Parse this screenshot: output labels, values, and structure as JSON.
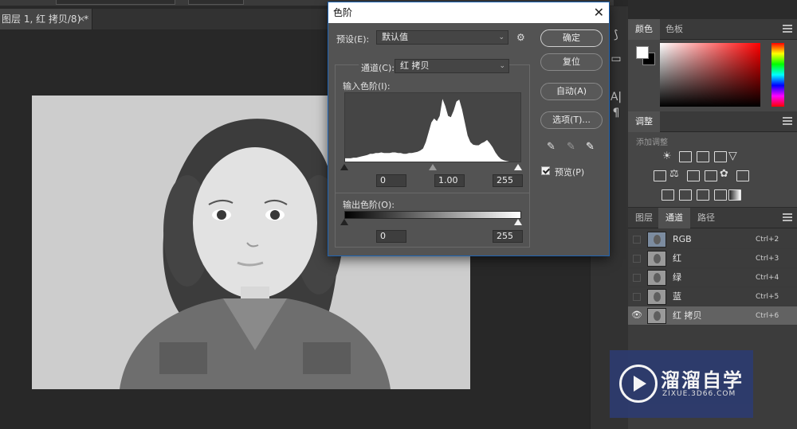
{
  "document": {
    "tab_title": "图层 1, 红 拷贝/8) *",
    "close_glyph": "×"
  },
  "levels_dialog": {
    "title": "色阶",
    "close_glyph": "✕",
    "preset_label": "预设(E):",
    "preset_value": "默认值",
    "channel_label": "通道(C):",
    "channel_value": "红 拷贝",
    "input_levels_label": "输入色阶(I):",
    "input_black": "0",
    "input_gamma": "1.00",
    "input_white": "255",
    "output_levels_label": "输出色阶(O):",
    "output_black": "0",
    "output_white": "255",
    "buttons": {
      "ok": "确定",
      "reset": "复位",
      "auto": "自动(A)",
      "options": "选项(T)..."
    },
    "preview_label": "预览(P)",
    "preview_checked": true,
    "histogram_levels": [
      0.05,
      0.05,
      0.05,
      0.06,
      0.06,
      0.07,
      0.08,
      0.09,
      0.1,
      0.12,
      0.12,
      0.13,
      0.13,
      0.14,
      0.13,
      0.13,
      0.13,
      0.14,
      0.14,
      0.13,
      0.13,
      0.12,
      0.12,
      0.13,
      0.13,
      0.14,
      0.15,
      0.17,
      0.2,
      0.3,
      0.45,
      0.6,
      0.66,
      0.62,
      0.7,
      0.96,
      0.85,
      0.7,
      0.68,
      0.78,
      0.92,
      0.95,
      0.8,
      0.6,
      0.4,
      0.3,
      0.26,
      0.25,
      0.25,
      0.28,
      0.3,
      0.33,
      0.28,
      0.22,
      0.14,
      0.08,
      0.04,
      0.02,
      0.01,
      0.0,
      0.0,
      0.0,
      0.0,
      0.0
    ]
  },
  "toolstrip": {
    "icons": [
      "paragraph-mark-icon",
      "character-a-icon"
    ],
    "glyphs": [
      "A|",
      "¶"
    ]
  },
  "color_panel": {
    "tabs": [
      "颜色",
      "色板"
    ],
    "foreground": "#ffffff",
    "background": "#000000"
  },
  "adjustments_panel": {
    "title": "调整",
    "subtitle": "添加调整"
  },
  "channels_panel": {
    "tabs": [
      "图层",
      "通道",
      "路径"
    ],
    "active_tab": "通道",
    "rows": [
      {
        "name": "RGB",
        "shortcut": "Ctrl+2",
        "visible": false
      },
      {
        "name": "红",
        "shortcut": "Ctrl+3",
        "visible": false
      },
      {
        "name": "绿",
        "shortcut": "Ctrl+4",
        "visible": false
      },
      {
        "name": "蓝",
        "shortcut": "Ctrl+5",
        "visible": false
      },
      {
        "name": "红 拷贝",
        "shortcut": "Ctrl+6",
        "visible": true
      }
    ]
  },
  "watermark": {
    "brand": "溜溜自学",
    "url": "ZIXUE.3D66.COM"
  }
}
